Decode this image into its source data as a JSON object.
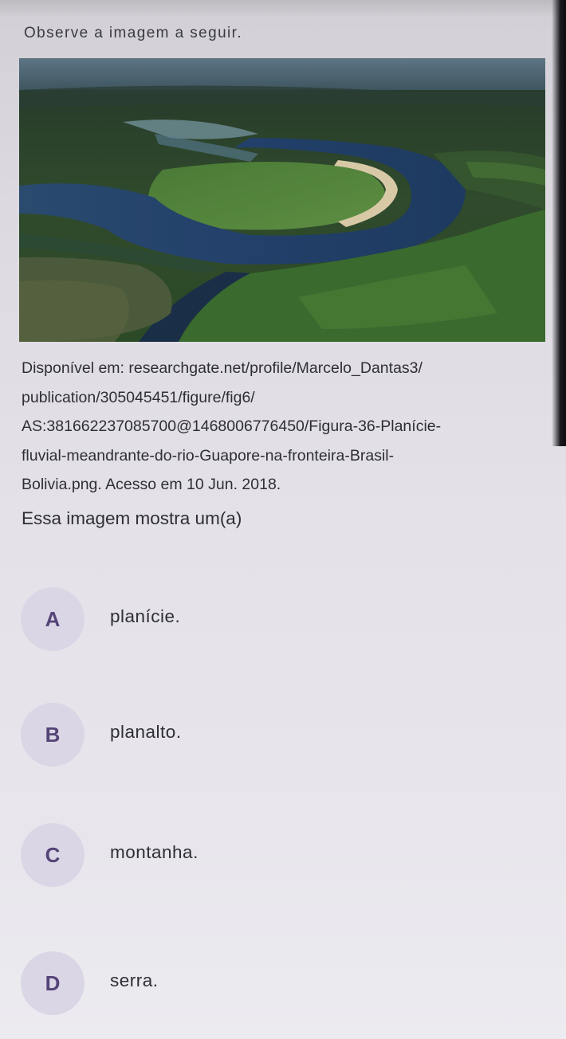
{
  "question": {
    "instruction": "Observe a imagem a seguir.",
    "image_alt": "Planície fluvial meandrante do rio Guaporé",
    "caption_lines": [
      "Disponível em: researchgate.net/profile/Marcelo_Dantas3/",
      "publication/305045451/figure/fig6/",
      "AS:381662237085700@1468006776450/Figura-36-Planície-",
      "fluvial-meandrante-do-rio-Guapore-na-fronteira-Brasil-",
      "Bolivia.png.  Acesso em 10 Jun. 2018."
    ],
    "prompt": "Essa imagem mostra um(a)"
  },
  "options": [
    {
      "letter": "A",
      "text": "planície."
    },
    {
      "letter": "B",
      "text": "planalto."
    },
    {
      "letter": "C",
      "text": "montanha."
    },
    {
      "letter": "D",
      "text": "serra."
    }
  ],
  "colors": {
    "badge_background": "#dbd6e6",
    "badge_letter": "#554477",
    "text": "#2e2e36"
  }
}
